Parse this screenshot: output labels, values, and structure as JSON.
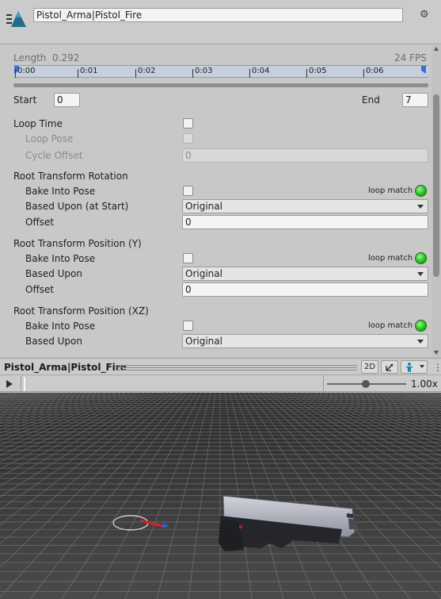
{
  "header": {
    "clip_name": "Pistol_Arma|Pistol_Fire",
    "icons": {
      "logo": "animation-clip-icon",
      "settings": "gear-icon"
    }
  },
  "timeline": {
    "length_label": "Length",
    "length_value": "0.292",
    "fps": "24 FPS",
    "ticks": [
      "0:00",
      "0:01",
      "0:02",
      "0:03",
      "0:04",
      "0:05",
      "0:06"
    ]
  },
  "range": {
    "start_label": "Start",
    "start_value": "0",
    "end_label": "End",
    "end_value": "7"
  },
  "loop": {
    "loop_time": "Loop Time",
    "loop_pose": "Loop Pose",
    "cycle_offset": "Cycle Offset",
    "cycle_offset_value": "0"
  },
  "rotation": {
    "title": "Root Transform Rotation",
    "bake": "Bake Into Pose",
    "loop_match": "loop match",
    "based_upon": "Based Upon (at Start)",
    "based_upon_value": "Original",
    "offset": "Offset",
    "offset_value": "0"
  },
  "position_y": {
    "title": "Root Transform Position (Y)",
    "bake": "Bake Into Pose",
    "loop_match": "loop match",
    "based_upon": "Based Upon",
    "based_upon_value": "Original",
    "offset": "Offset",
    "offset_value": "0"
  },
  "position_xz": {
    "title": "Root Transform Position (XZ)",
    "bake": "Bake Into Pose",
    "loop_match": "loop match",
    "based_upon": "Based Upon",
    "based_upon_value": "Original"
  },
  "preview": {
    "title": "Pistol_Arma|Pistol_Fire",
    "mode_2d": "2D",
    "speed": "1.00x",
    "speed_fraction": 0.46,
    "scrub_fraction": 0.0
  },
  "colors": {
    "loop_match_led": "#1fc51a",
    "timeline_bg": "#c7cfdc",
    "marker": "#3b6fd8",
    "logo": "#1f6f8b"
  }
}
